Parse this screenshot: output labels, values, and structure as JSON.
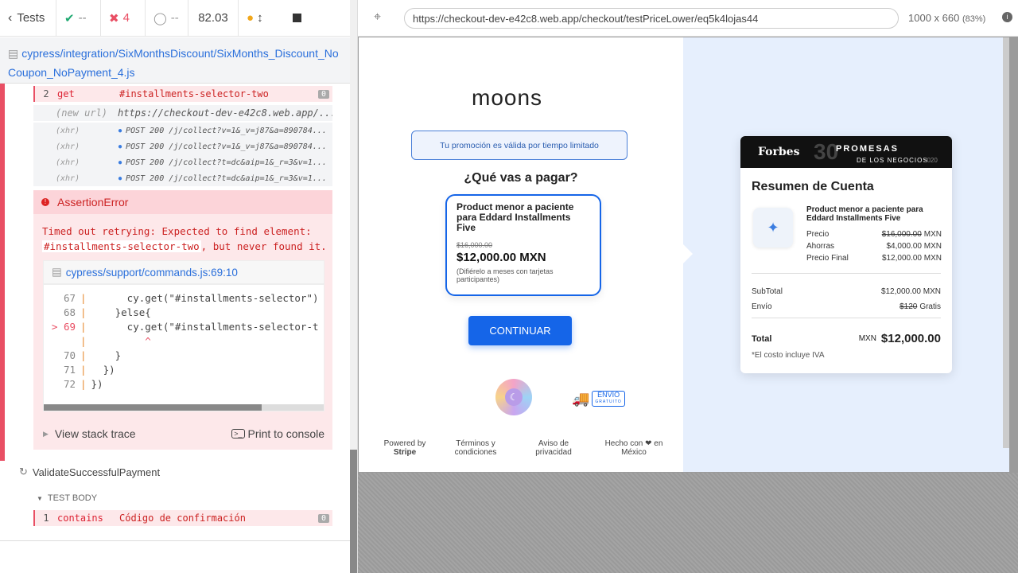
{
  "reporter": {
    "tests_label": "Tests",
    "passed": "--",
    "failed": "4",
    "pending": "--",
    "duration": "82.03",
    "spec_path": "cypress/integration/SixMonthsDiscount/SixMonths_Discount_NoCoupon_NoPayment_4.js",
    "commands": [
      {
        "num": "2",
        "name": "get",
        "msg": "#installments-selector-two",
        "badge": "0"
      },
      {
        "num": "",
        "name": "(new url)",
        "msg": "https://checkout-dev-e42c8.web.app/..."
      },
      {
        "num": "",
        "name": "(xhr)",
        "msg": "POST 200 /j/collect?v=1&_v=j87&a=890784..."
      },
      {
        "num": "",
        "name": "(xhr)",
        "msg": "POST 200 /j/collect?v=1&_v=j87&a=890784..."
      },
      {
        "num": "",
        "name": "(xhr)",
        "msg": "POST 200 /j/collect?t=dc&aip=1&_r=3&v=1..."
      },
      {
        "num": "",
        "name": "(xhr)",
        "msg": "POST 200 /j/collect?t=dc&aip=1&_r=3&v=1..."
      }
    ],
    "error": {
      "title": "AssertionError",
      "line1": "Timed out retrying: Expected to find element:",
      "selector": "#installments-selector-two",
      "line2": ", but never found it.",
      "file": "cypress/support/commands.js:69:10",
      "code": [
        {
          "n": "67",
          "t": "      cy.get(\"#installments-selector\")"
        },
        {
          "n": "68",
          "t": "    }else{"
        },
        {
          "n": "> 69",
          "t": "      cy.get(\"#installments-selector-t"
        },
        {
          "n": "",
          "t": "         ^"
        },
        {
          "n": "70",
          "t": "    }"
        },
        {
          "n": "71",
          "t": "  })"
        },
        {
          "n": "72",
          "t": "})"
        }
      ],
      "stack": "View stack trace",
      "print": "Print to console"
    },
    "next_test": "ValidateSuccessfulPayment",
    "test_body": "TEST BODY",
    "last_cmd": {
      "num": "1",
      "name": "contains",
      "msg": "Código de confirmación",
      "badge": "0"
    }
  },
  "browser": {
    "url": "https://checkout-dev-e42c8.web.app/checkout/testPriceLower/eq5k4lojas44",
    "size": "1000 x 660",
    "zoom": "(83%)"
  },
  "checkout": {
    "logo": "moons",
    "promo": "Tu promoción es válida por tiempo limitado",
    "question": "¿Qué vas a pagar?",
    "product_title": "Product menor a paciente para Eddard Installments Five",
    "old_price": "$16,000.00",
    "price": "$12,000.00 MXN",
    "defer": "(Difiérelo a meses con tarjetas participantes)",
    "continue": "CONTINUAR",
    "envio": "ENVÍO",
    "gratuito": "GRATUITO",
    "footer": [
      {
        "a": "Powered by",
        "b": "Stripe"
      },
      {
        "a": "Términos y",
        "b": "condiciones"
      },
      {
        "a": "Aviso de",
        "b": "privacidad"
      },
      {
        "a": "Hecho con ❤ en",
        "b": "México"
      }
    ],
    "forbes": "Forbes",
    "promesas_1": "PROMESAS",
    "promesas_2": "DE LOS NEGOCIOS",
    "year": "2020",
    "promesas_num": "30",
    "summary_title": "Resumen de Cuenta",
    "item_title": "Product menor a paciente para Eddard Installments Five",
    "precio_label": "Precio",
    "precio_old": "$16,000.00",
    "precio_unit": "MXN",
    "ahorras_label": "Ahorras",
    "ahorras_val": "$4,000.00 MXN",
    "final_label": "Precio Final",
    "final_val": "$12,000.00 MXN",
    "subtotal_label": "SubTotal",
    "subtotal_val": "$12,000.00 MXN",
    "envio_label": "Envío",
    "envio_old": "$120",
    "envio_free": "Gratis",
    "total_label": "Total",
    "total_cur": "MXN",
    "total_val": "$12,000.00",
    "iva": "*El costo incluye IVA"
  },
  "colors": {
    "accent": "#1565e8",
    "fail": "#e94f64",
    "pass": "#1fa971"
  }
}
